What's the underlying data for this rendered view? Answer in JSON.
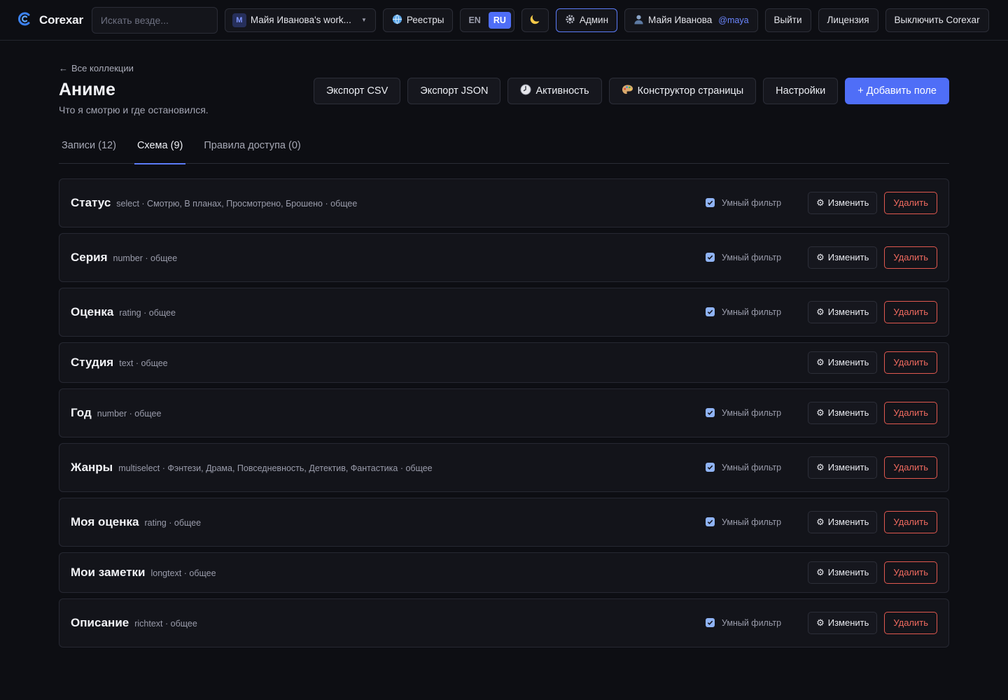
{
  "topbar": {
    "brand": "Corexar",
    "search_placeholder": "Искать везде...",
    "workspace_badge": "M",
    "workspace_name": "Майя Иванова's work...",
    "registries": "Реестры",
    "lang_en": "EN",
    "lang_ru": "RU",
    "lang_selected": "RU",
    "admin": "Админ",
    "user_name": "Майя Иванова",
    "user_handle": "@maya",
    "logout": "Выйти",
    "license": "Лицензия",
    "disable": "Выключить Corexar"
  },
  "page": {
    "back_link": "Все коллекции",
    "title": "Аниме",
    "subtitle": "Что я смотрю и где остановился.",
    "export_csv": "Экспорт CSV",
    "export_json": "Экспорт JSON",
    "activity": "Активность",
    "page_builder": "Конструктор страницы",
    "settings": "Настройки",
    "add_field": "+ Добавить поле"
  },
  "tabs": [
    {
      "label": "Записи (12)",
      "active": false
    },
    {
      "label": "Схема (9)",
      "active": true
    },
    {
      "label": "Правила доступа (0)",
      "active": false
    }
  ],
  "labels": {
    "smart_filter": "Умный фильтр",
    "edit": "Изменить",
    "delete": "Удалить"
  },
  "fields": [
    {
      "name": "Статус",
      "meta": "select · Смотрю, В планах, Просмотрено, Брошено · общее",
      "smart_filter": true
    },
    {
      "name": "Серия",
      "meta": "number · общее",
      "smart_filter": true
    },
    {
      "name": "Оценка",
      "meta": "rating · общее",
      "smart_filter": true
    },
    {
      "name": "Студия",
      "meta": "text · общее",
      "smart_filter": false
    },
    {
      "name": "Год",
      "meta": "number · общее",
      "smart_filter": true
    },
    {
      "name": "Жанры",
      "meta": "multiselect · Фэнтези, Драма, Повседневность, Детектив, Фантастика · общее",
      "smart_filter": true
    },
    {
      "name": "Моя оценка",
      "meta": "rating · общее",
      "smart_filter": true
    },
    {
      "name": "Мои заметки",
      "meta": "longtext · общее",
      "smart_filter": false
    },
    {
      "name": "Описание",
      "meta": "richtext · общее",
      "smart_filter": true
    }
  ],
  "colors": {
    "accent": "#4f6ef7",
    "danger": "#f06a5f",
    "background": "#0d0e13",
    "card": "#13141a"
  }
}
